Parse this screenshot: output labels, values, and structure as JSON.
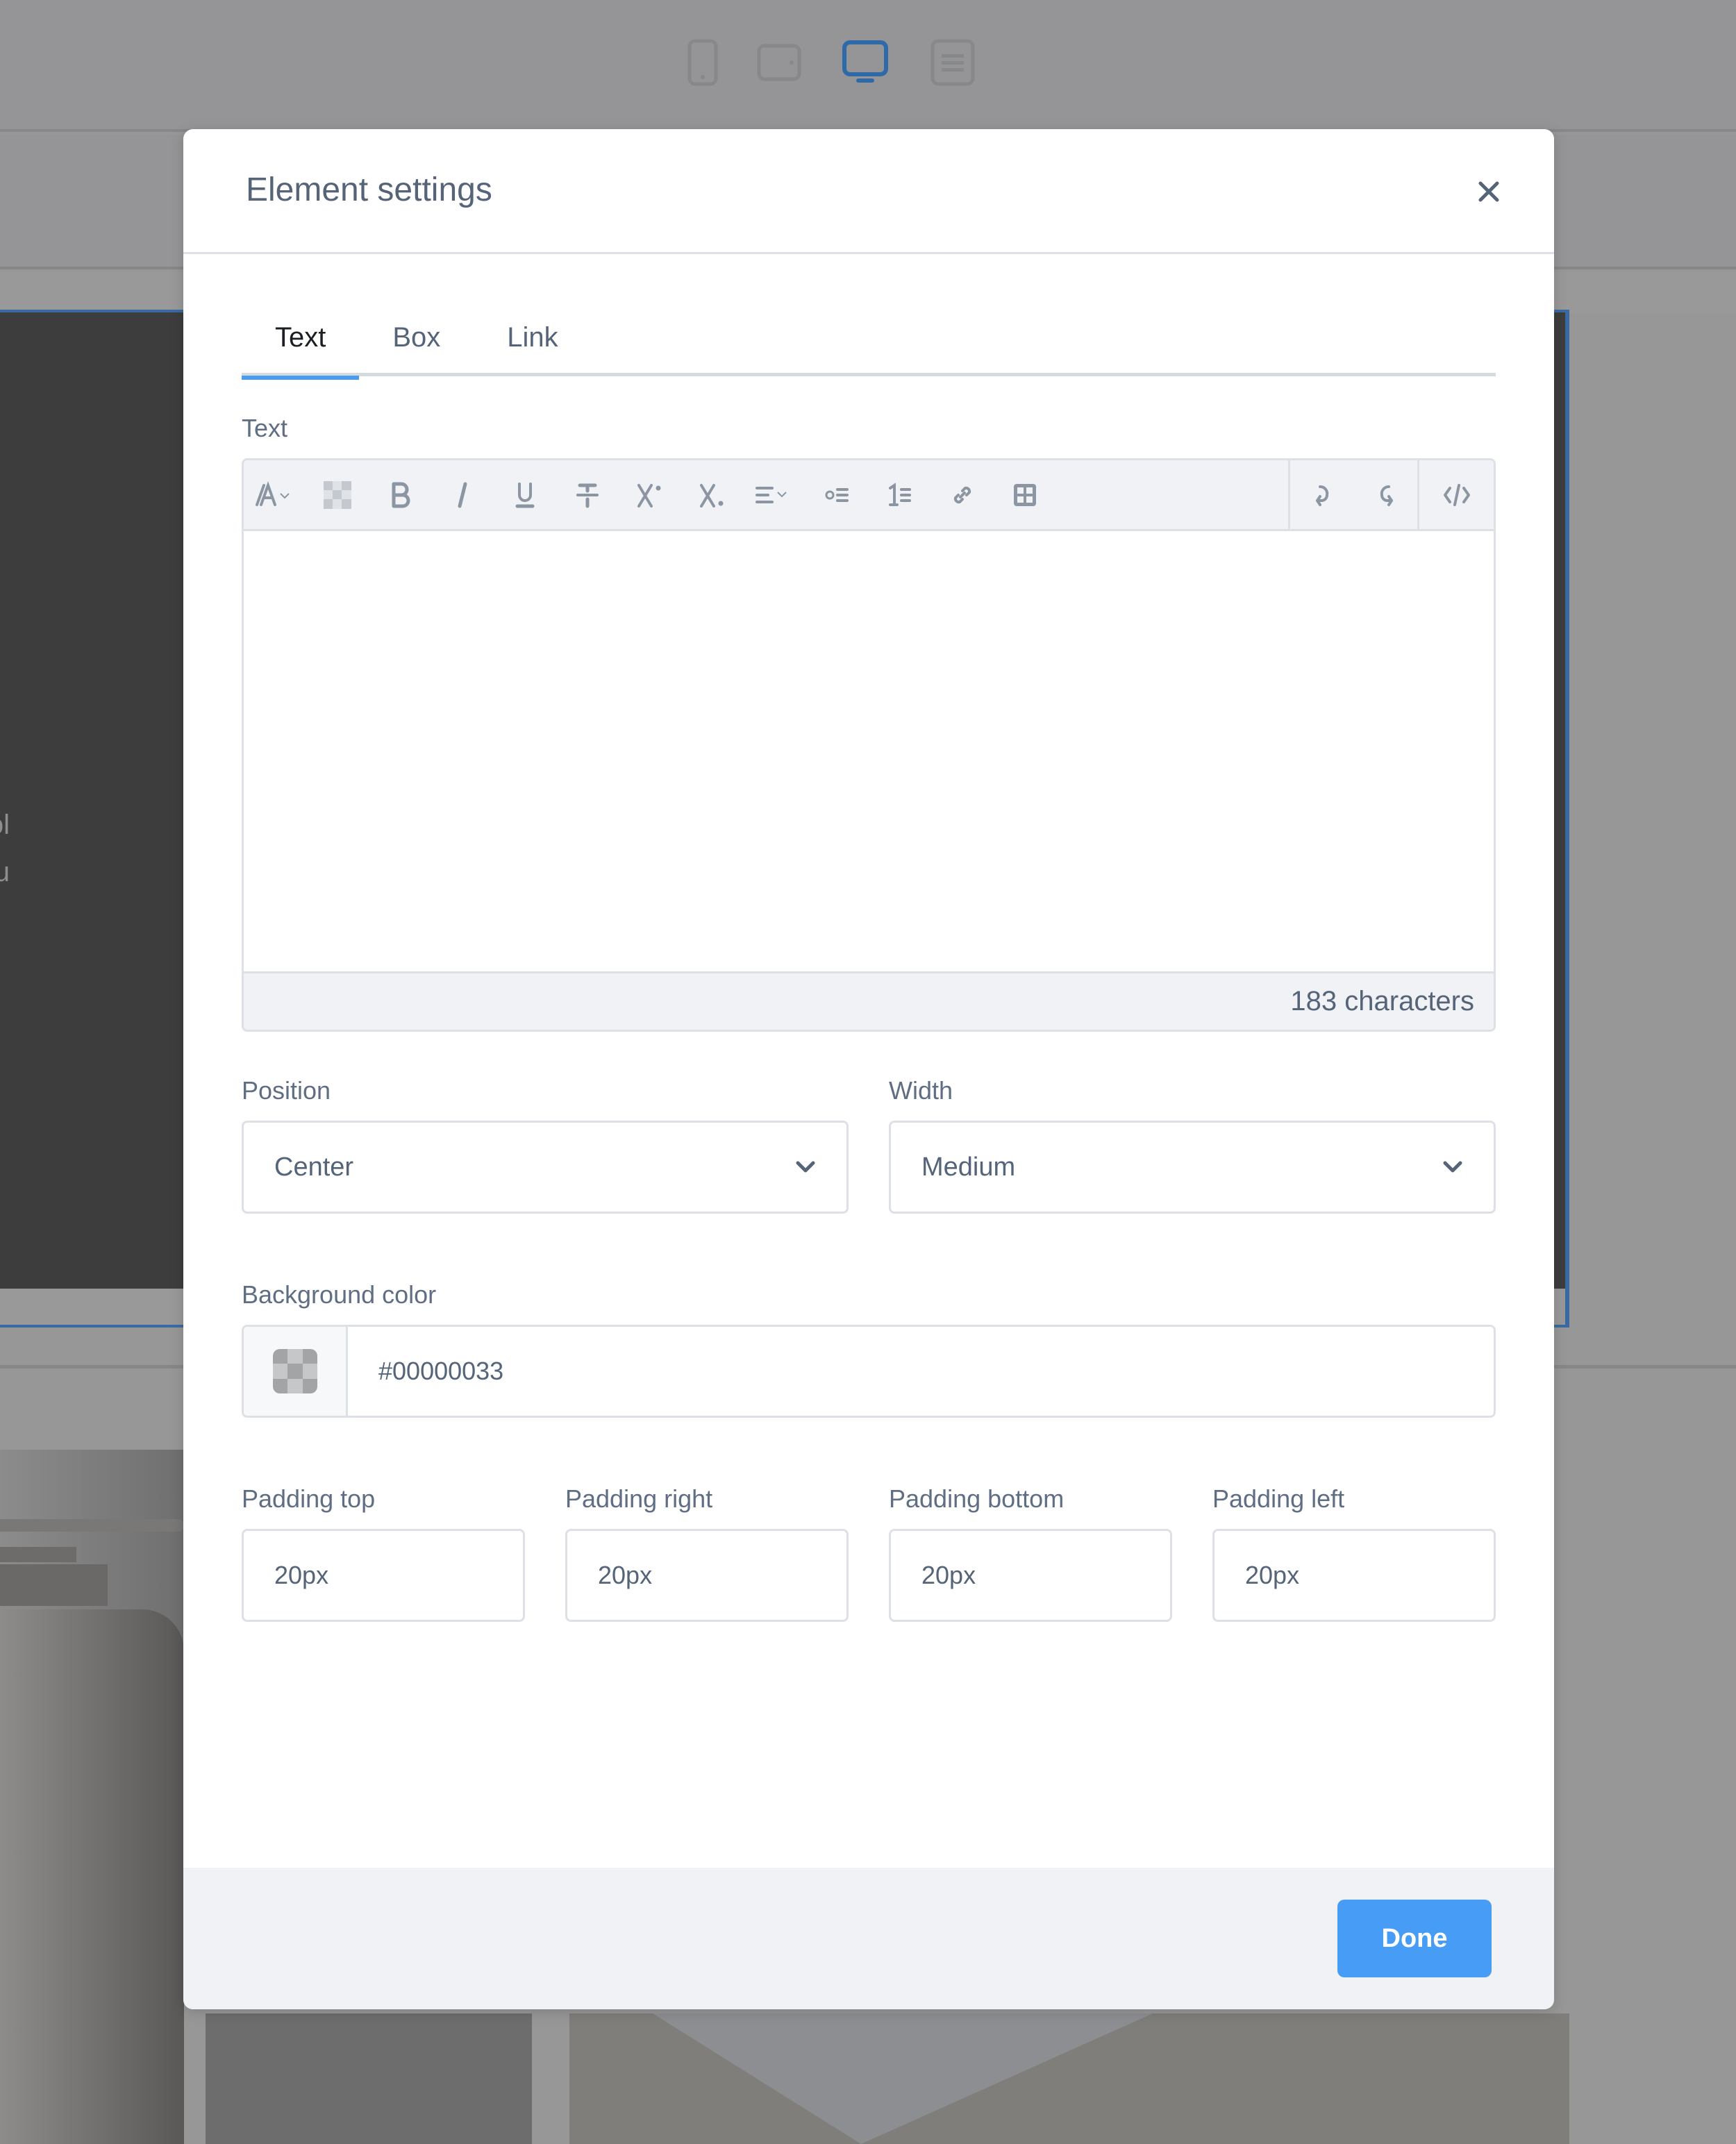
{
  "background": {
    "device_icons": [
      {
        "name": "mobile-view-icon",
        "active": false
      },
      {
        "name": "tablet-view-icon",
        "active": false
      },
      {
        "name": "desktop-view-icon",
        "active": true
      },
      {
        "name": "document-view-icon",
        "active": false
      }
    ],
    "preview_text_line1": "rem ipsum dol",
    "preview_text_line2": "invidu"
  },
  "modal": {
    "title": "Element settings",
    "close_icon": "close-icon",
    "tabs": [
      {
        "label": "Text",
        "active": true
      },
      {
        "label": "Box",
        "active": false
      },
      {
        "label": "Link",
        "active": false
      }
    ],
    "text_field": {
      "label": "Text",
      "toolbar": [
        {
          "name": "font-style-icon",
          "glyph": "A"
        },
        {
          "name": "text-color-icon",
          "glyph": "checker"
        },
        {
          "name": "bold-icon",
          "glyph": "B"
        },
        {
          "name": "italic-icon",
          "glyph": "I"
        },
        {
          "name": "underline-icon",
          "glyph": "U"
        },
        {
          "name": "strikethrough-icon",
          "glyph": "T"
        },
        {
          "name": "superscript-icon",
          "glyph": "X"
        },
        {
          "name": "subscript-icon",
          "glyph": "X"
        },
        {
          "name": "align-icon",
          "glyph": "≡"
        },
        {
          "name": "bullet-list-icon",
          "glyph": "•"
        },
        {
          "name": "numbered-list-icon",
          "glyph": "1"
        },
        {
          "name": "link-icon",
          "glyph": "∞"
        },
        {
          "name": "table-icon",
          "glyph": "⊞"
        }
      ],
      "toolbar_right": [
        {
          "name": "undo-icon"
        },
        {
          "name": "redo-icon"
        },
        {
          "name": "code-view-icon"
        }
      ],
      "content": "",
      "char_count": "183 characters"
    },
    "position": {
      "label": "Position",
      "value": "Center"
    },
    "width": {
      "label": "Width",
      "value": "Medium"
    },
    "background_color": {
      "label": "Background color",
      "value": "#00000033"
    },
    "padding": [
      {
        "label": "Padding top",
        "value": "20px"
      },
      {
        "label": "Padding right",
        "value": "20px"
      },
      {
        "label": "Padding bottom",
        "value": "20px"
      },
      {
        "label": "Padding left",
        "value": "20px"
      }
    ],
    "done_label": "Done"
  },
  "colors": {
    "accent": "#479df5",
    "active_device": "#2f6aa8",
    "label": "#556478",
    "border": "#dde1e5",
    "toolbar_bg": "#f0f2f5"
  }
}
